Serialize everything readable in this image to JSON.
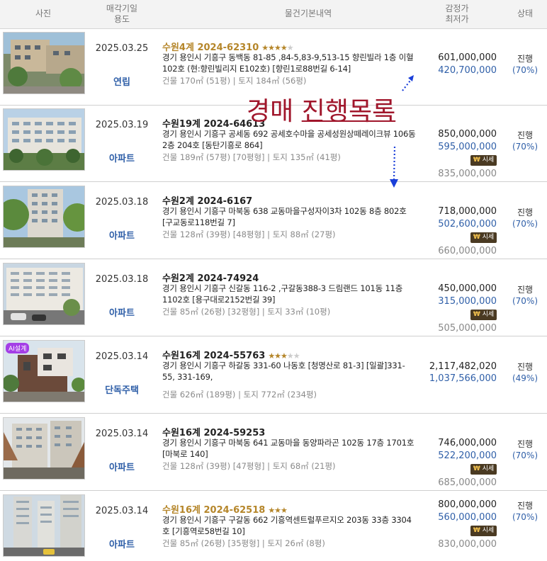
{
  "header": {
    "photo": "사진",
    "date_line1": "매각기일",
    "date_line2": "용도",
    "info": "물건기본내역",
    "price_line1": "감정가",
    "price_line2": "최저가",
    "status": "상태"
  },
  "overlay_text": {
    "part1": "경매",
    "part2": "진행목록"
  },
  "market_tag": {
    "label": "시세"
  },
  "items": [
    {
      "date": "2025.03.25",
      "type": "연립",
      "case": "수원4계 2024-62310",
      "stars_on": "★★★★",
      "stars_off": "★",
      "address": "경기 용인시 기흥구 동백동 81-85 ,84-5,83-9,513-15 향린빌라 1층 이혈102호 (현:향린빌리지 E102호) [향린1로88번길 6-14]",
      "area": "건물 170㎡ (51평)  |  토지 184㎡ (56평)",
      "appraisal": "601,000,000",
      "min_bid": "420,700,000",
      "market": "",
      "status": "진행",
      "percent": "(70%)"
    },
    {
      "date": "2025.03.19",
      "type": "아파트",
      "case": "수원19계 2024-64613",
      "stars_on": "",
      "stars_off": "",
      "address": "경기 용인시 기흥구 공세동 692 공세호수마을 공세성원상떼레이크뷰 106동 2층 204호 [동탄기흥로 864]",
      "area": "건물 189㎡ (57평) [70평형]  |  토지 135㎡ (41평)",
      "appraisal": "850,000,000",
      "min_bid": "595,000,000",
      "market": "835,000,000",
      "status": "진행",
      "percent": "(70%)"
    },
    {
      "date": "2025.03.18",
      "type": "아파트",
      "case": "수원2계 2024-6167",
      "stars_on": "",
      "stars_off": "",
      "address": "경기 용인시 기흥구 마북동 638 교동마을구성자이3차 102동 8층 802호 [구교동로118번길 7]",
      "area": "건물 128㎡ (39평) [48평형]  |  토지 88㎡ (27평)",
      "appraisal": "718,000,000",
      "min_bid": "502,600,000",
      "market": "660,000,000",
      "status": "진행",
      "percent": "(70%)"
    },
    {
      "date": "2025.03.18",
      "type": "아파트",
      "case": "수원2계 2024-74924",
      "stars_on": "",
      "stars_off": "",
      "address": "경기 용인시 기흥구 신갈동 116-2 ,구갈동388-3 드림랜드 101동 11층 1102호 [용구대로2152번길 39]",
      "area": "건물 85㎡ (26평) [32평형]  |  토지 33㎡ (10평)",
      "appraisal": "450,000,000",
      "min_bid": "315,000,000",
      "market": "505,000,000",
      "status": "진행",
      "percent": "(70%)"
    },
    {
      "date": "2025.03.14",
      "type": "단독주택",
      "case": "수원16계 2024-55763",
      "stars_on": "★★★",
      "stars_off": "★★",
      "address": "경기 용인시 기흥구 하갈동 331-60 나동호 [청명산로 81-3]  [일괄]331-55, 331-169,",
      "area": "건물 626㎡ (189평)  |  토지 772㎡ (234평)",
      "appraisal": "2,117,482,020",
      "min_bid": "1,037,566,000",
      "market": "",
      "status": "진행",
      "percent": "(49%)",
      "badge": "AI설계"
    },
    {
      "date": "2025.03.14",
      "type": "아파트",
      "case": "수원16계 2024-59253",
      "stars_on": "",
      "stars_off": "",
      "address": "경기 용인시 기흥구 마북동 641 교동마을 동양파라곤 102동 17층 1701호 [마북로 140]",
      "area": "건물 128㎡ (39평) [47평형]  |  토지 68㎡ (21평)",
      "appraisal": "746,000,000",
      "min_bid": "522,200,000",
      "market": "685,000,000",
      "status": "진행",
      "percent": "(70%)"
    },
    {
      "date": "2025.03.14",
      "type": "아파트",
      "case": "수원16계 2024-62518",
      "stars_on": "★★★",
      "stars_off": "",
      "address": "경기 용인시 기흥구 구갈동 662 기흥역센트럴푸르지오 203동 33층 3304호 [기흥역로58번길 10]",
      "area": "건물 85㎡ (26평) [35평형]  |  토지 26㎡ (8평)",
      "appraisal": "800,000,000",
      "min_bid": "560,000,000",
      "market": "830,000,000",
      "status": "진행",
      "percent": "(70%)"
    }
  ],
  "colors": {
    "accent_blue": "#2f5fa8",
    "gold": "#b5862a",
    "overlay_red": "#a0162b",
    "arrow_blue": "#1a3fd9"
  }
}
